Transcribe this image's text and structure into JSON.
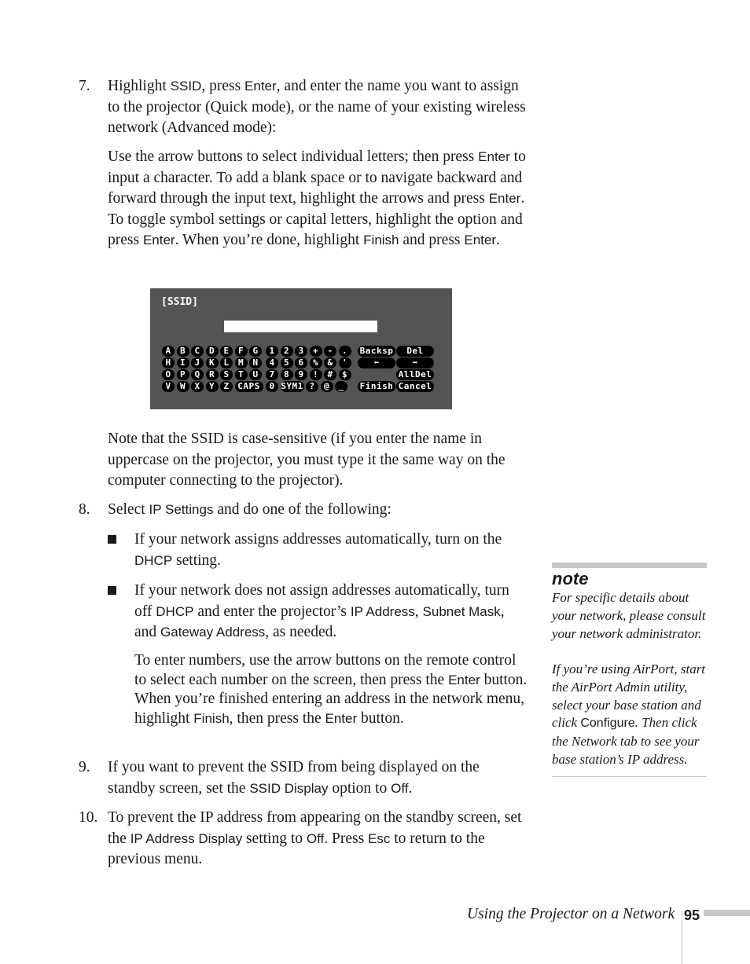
{
  "step7": {
    "number": "7.",
    "t1": "Highlight ",
    "k1": "SSID",
    "t2": ", press ",
    "k2": "Enter",
    "t3": ", and enter the name you want to assign to the projector (Quick mode), or the name of your existing wireless network (Advanced mode):",
    "p": {
      "t1": "Use the arrow buttons to select individual letters; then press ",
      "k1": "Enter",
      "t2": " to input a character. To add a blank space or to navigate backward and forward through the input text, highlight the arrows and press ",
      "k2": "Enter",
      "t3": ". To toggle symbol settings or capital letters, highlight the option and press ",
      "k3": "Enter",
      "t4": ". When you’re done, highlight ",
      "k4": "Finish",
      "t5": " and press ",
      "k5": "Enter",
      "t6": "."
    },
    "note_after": "Note that the SSID is case-sensitive (if you enter the name in uppercase on the projector, you must type it the same way on the computer connecting to the projector)."
  },
  "screen": {
    "title": "[SSID]",
    "input_value": "",
    "letters": [
      [
        "A",
        "B",
        "C",
        "D",
        "E",
        "F",
        "G"
      ],
      [
        "H",
        "I",
        "J",
        "K",
        "L",
        "M",
        "N"
      ],
      [
        "O",
        "P",
        "Q",
        "R",
        "S",
        "T",
        "U"
      ],
      [
        "V",
        "W",
        "X",
        "Y",
        "Z",
        "CAPS"
      ]
    ],
    "symbols": [
      [
        "1",
        "2",
        "3",
        "+",
        "-",
        "."
      ],
      [
        "4",
        "5",
        "6",
        "%",
        "&",
        "'"
      ],
      [
        "7",
        "8",
        "9",
        "!",
        "#",
        "$"
      ],
      [
        "0",
        "SYM1",
        "?",
        "@",
        "_"
      ]
    ],
    "backsp": "Backsp",
    "del": "Del",
    "left": "⬅",
    "right": "➡",
    "alldel": "AllDel",
    "finish": "Finish",
    "cancel": "Cancel"
  },
  "step8": {
    "number": "8.",
    "t1": "Select ",
    "k1": "IP Settings",
    "t2": " and do one of the following:",
    "b1": {
      "t1": "If your network assigns addresses automatically, turn on the ",
      "k1": "DHCP",
      "t2": " setting."
    },
    "b2": {
      "t1": "If your network does not assign addresses automatically, turn off ",
      "k1": "DHCP",
      "t2": " and enter the projector’s ",
      "k2": "IP Address",
      "t3": ", ",
      "k3": "Subnet Mask",
      "t4": ", and ",
      "k4": "Gateway Address",
      "t5": ", as needed."
    },
    "p": {
      "t1": "To enter numbers, use the arrow buttons on the remote control to select each number on the screen, then press the ",
      "k1": "Enter",
      "t2": " button. When you’re finished entering an address in the network menu, highlight ",
      "k2": "Finish",
      "t3": ", then press the ",
      "k3": "Enter",
      "t4": " button."
    }
  },
  "step9": {
    "number": "9.",
    "t1": "If you want to prevent the SSID from being displayed on the standby screen, set the ",
    "k1": "SSID Display",
    "t2": " option to ",
    "k2": "Off",
    "t3": "."
  },
  "step10": {
    "number": "10.",
    "t1": "To prevent the IP address from appearing on the standby screen, set the ",
    "k1": "IP Address Display",
    "t2": " setting to ",
    "k2": "Off",
    "t3": ". Press ",
    "k3": "Esc",
    "t4": " to return to the previous menu."
  },
  "note": {
    "heading": "note",
    "p1": "For specific details about your network, please consult your network administrator.",
    "p2": {
      "t1": "If you’re using AirPort, start the AirPort Admin utility, select your base station and click ",
      "k1": "Configure",
      "t2": ". Then click the Network tab to see your base station’s IP address."
    }
  },
  "footer": {
    "title": "Using the Projector on a Network",
    "page": "95"
  }
}
